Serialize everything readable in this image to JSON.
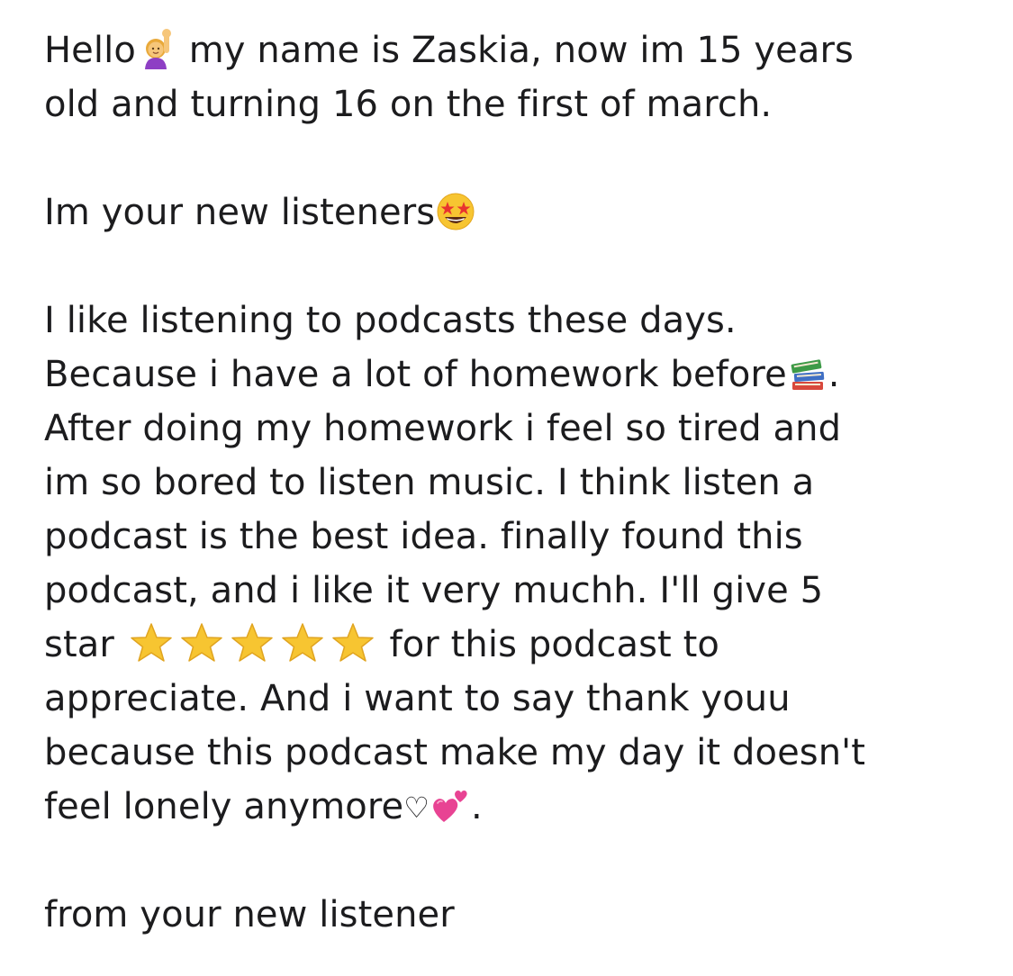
{
  "note": {
    "line1_a": "Hello",
    "line1_b": "  my name is Zaskia, now im 15 years",
    "line2": "old and turning 16 on the first of march.",
    "line3": "Im your new listeners",
    "line4": "I like listening to podcasts these days.",
    "line5_a": "Because i have a lot of homework before",
    "line5_b": ".",
    "line6": "After doing my homework i feel so tired and",
    "line7": "im so bored to listen music. I think listen a",
    "line8": "podcast is the best idea. finally found this",
    "line9": "podcast, and i like it very muchh. I'll give 5",
    "line10_a": "star ",
    "line10_b": " for this podcast to",
    "line11": "appreciate. And i want to say thank youu",
    "line12": "because this podcast make my day it doesn't",
    "line13_a": "feel lonely anymore",
    "line13_heart": "♡",
    "line13_b": ".",
    "line14": "from your new listener"
  },
  "icons": {
    "greeting": "woman-raising-hand-icon",
    "excited": "star-struck-face-icon",
    "books": "books-icon",
    "rating": "star-icon",
    "love": "two-hearts-icon"
  },
  "colors": {
    "text": "#1c1c1e",
    "background": "#ffffff",
    "star": "#f7c531",
    "heart": "#e84393"
  }
}
